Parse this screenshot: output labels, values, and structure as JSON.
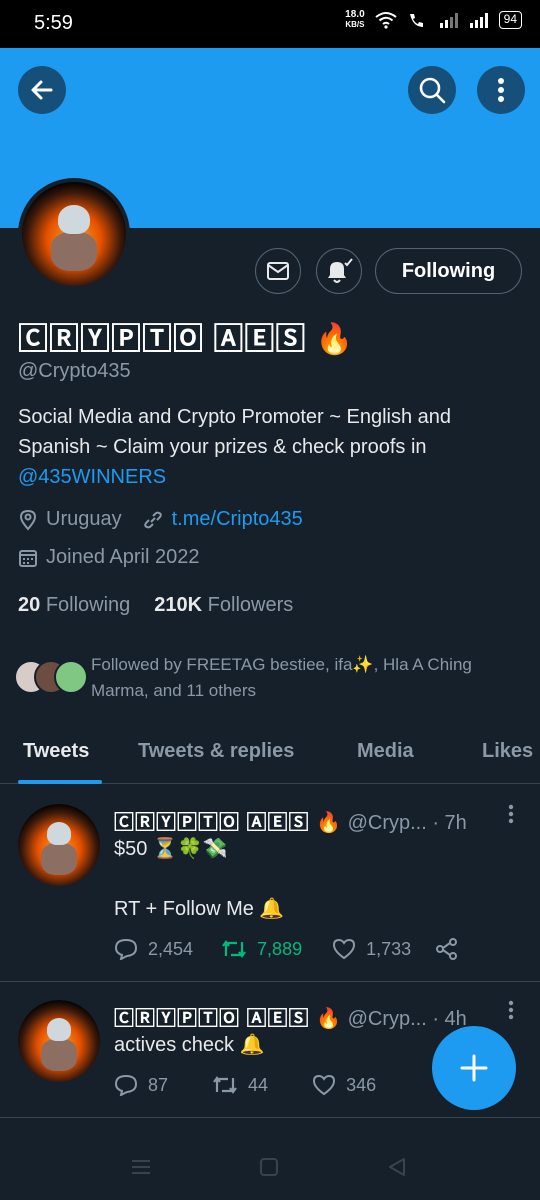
{
  "status": {
    "time": "5:59",
    "speed_value": "18.0",
    "speed_unit": "KB/S",
    "battery": "94"
  },
  "profile": {
    "name": "🄲🅁🅈🄿🅃🄾 🄰🄴🅂 🔥",
    "handle": "@Crypto435",
    "bio_text": "Social Media and Crypto Promoter ~ English and Spanish ~ Claim your prizes & check proofs in",
    "bio_link": "@435WINNERS",
    "location": "Uruguay",
    "website": "t.me/Cripto435",
    "joined": "Joined April 2022",
    "following_count": "20",
    "following_label": "Following",
    "followers_count": "210K",
    "followers_label": "Followers",
    "followed_by": "Followed by FREETAG bestiee, ifa✨, Hla A Ching Marma, and 11 others",
    "follow_button": "Following"
  },
  "tabs": [
    "Tweets",
    "Tweets & replies",
    "Media",
    "Likes"
  ],
  "tweets": [
    {
      "name": "🄲🅁🅈🄿🅃🄾 🄰🄴🅂 🔥",
      "handle": "@Cryp...",
      "time": "· 7h",
      "line1": "$50 ⏳🍀💸",
      "line2": "RT + Follow Me 🔔",
      "replies": "2,454",
      "retweets": "7,889",
      "likes": "1,733"
    },
    {
      "name": "🄲🅁🅈🄿🅃🄾 🄰🄴🅂 🔥",
      "handle": "@Cryp...",
      "time": "· 4h",
      "line1": "actives check 🔔",
      "replies": "87",
      "retweets": "44",
      "likes": "346"
    }
  ],
  "colors": {
    "accent": "#1d9bf0",
    "background": "#15202b",
    "retweet_active": "#00ba7c"
  }
}
